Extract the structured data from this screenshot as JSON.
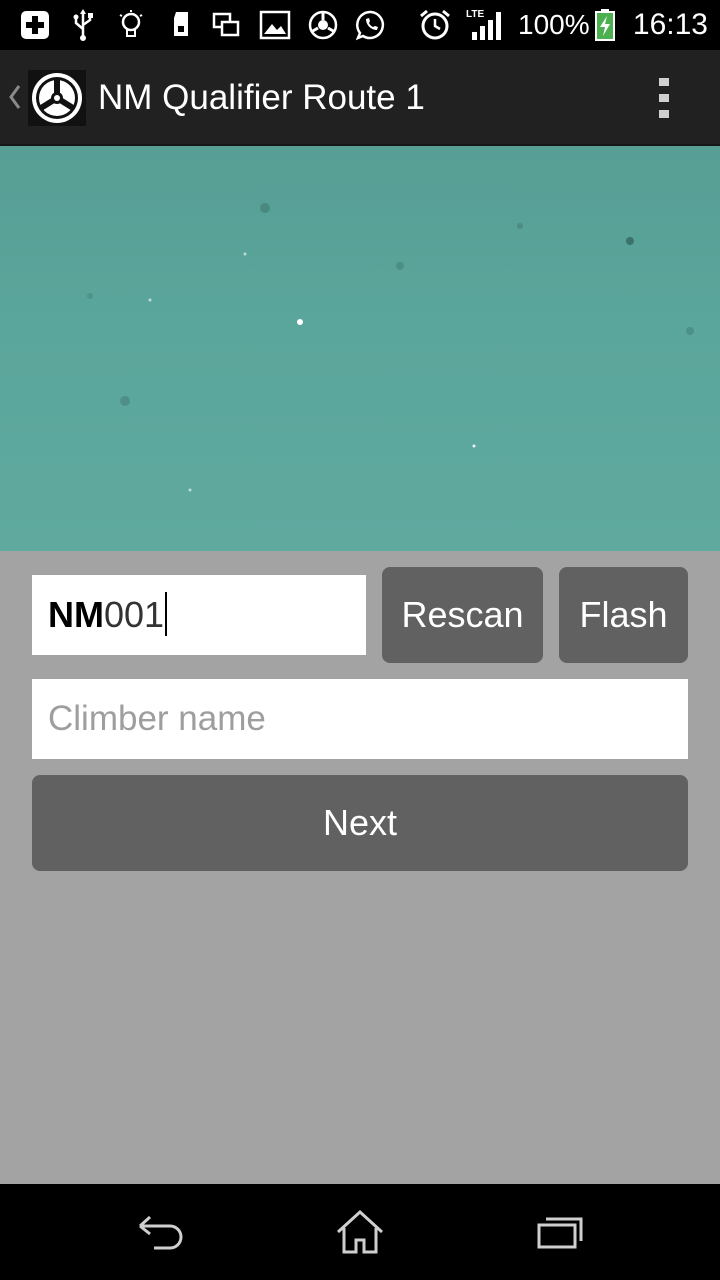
{
  "status_bar": {
    "icons": [
      "add-box-icon",
      "usb-icon",
      "lightbulb-icon",
      "sd-card-icon",
      "screenshot-icon",
      "image-icon",
      "app-icon",
      "whatsapp-icon",
      "alarm-icon",
      "lte-signal-icon",
      "battery-charging-icon"
    ],
    "network_label": "LTE",
    "battery_percent": "100%",
    "time": "16:13"
  },
  "action_bar": {
    "title": "NM Qualifier Route 1",
    "logo_icon": "app-logo-icon",
    "overflow_icon": "more-vert-icon"
  },
  "form": {
    "code_prefix": "NM",
    "code_value": "001",
    "rescan_label": "Rescan",
    "flash_label": "Flash",
    "climber_placeholder": "Climber name",
    "next_label": "Next"
  },
  "nav_bar": {
    "icons": [
      "back-icon",
      "home-icon",
      "recents-icon"
    ]
  },
  "colors": {
    "form_background": "#a3a3a3",
    "button": "#616161",
    "action_bar": "#212121",
    "camera_teal": "#5ba69c"
  }
}
